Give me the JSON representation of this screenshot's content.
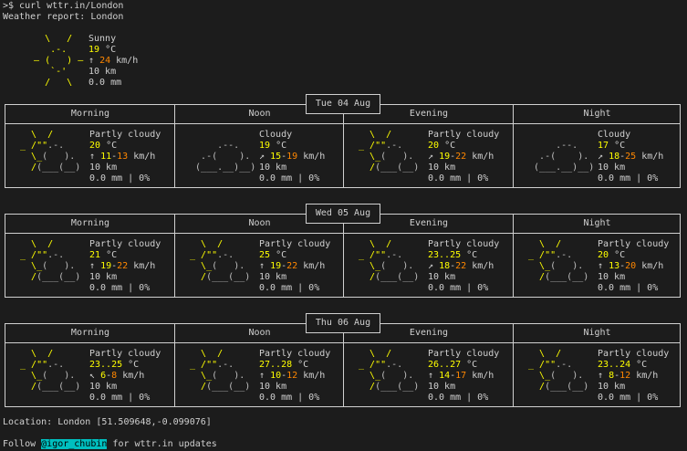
{
  "prompt": ">$ curl wttr.in/London",
  "report_title": "Weather report: London",
  "current": {
    "condition": "Sunny",
    "temp": "19",
    "temp_unit": "°C",
    "wind_arrow": "↑",
    "wind_speed": "24",
    "wind_unit": "km/h",
    "visibility": "10 km",
    "precip": "0.0 mm"
  },
  "columns": [
    "Morning",
    "Noon",
    "Evening",
    "Night"
  ],
  "days": [
    {
      "label": "Tue 04 Aug",
      "cells": [
        {
          "cond": "Partly cloudy",
          "icon": "partly-cloudy",
          "temp": "20",
          "arrow": "↑",
          "wind_lo": "11",
          "wind_hi": "13",
          "vis": "10 km",
          "precip": "0.0 mm | 0%"
        },
        {
          "cond": "Cloudy",
          "icon": "cloudy",
          "temp": "19",
          "arrow": "↗",
          "wind_lo": "15",
          "wind_hi": "19",
          "vis": "10 km",
          "precip": "0.0 mm | 0%"
        },
        {
          "cond": "Partly cloudy",
          "icon": "partly-cloudy",
          "temp": "20",
          "arrow": "↗",
          "wind_lo": "19",
          "wind_hi": "22",
          "vis": "10 km",
          "precip": "0.0 mm | 0%"
        },
        {
          "cond": "Cloudy",
          "icon": "cloudy",
          "temp": "17",
          "arrow": "↗",
          "wind_lo": "18",
          "wind_hi": "25",
          "vis": "10 km",
          "precip": "0.0 mm | 0%"
        }
      ]
    },
    {
      "label": "Wed 05 Aug",
      "cells": [
        {
          "cond": "Partly cloudy",
          "icon": "partly-cloudy",
          "temp": "21",
          "arrow": "↑",
          "wind_lo": "19",
          "wind_hi": "22",
          "vis": "10 km",
          "precip": "0.0 mm | 0%"
        },
        {
          "cond": "Partly cloudy",
          "icon": "partly-cloudy",
          "temp": "25",
          "arrow": "↑",
          "wind_lo": "19",
          "wind_hi": "22",
          "vis": "10 km",
          "precip": "0.0 mm | 0%"
        },
        {
          "cond": "Partly cloudy",
          "icon": "partly-cloudy",
          "temp": "23..25",
          "arrow": "↗",
          "wind_lo": "18",
          "wind_hi": "22",
          "vis": "10 km",
          "precip": "0.0 mm | 0%"
        },
        {
          "cond": "Partly cloudy",
          "icon": "partly-cloudy",
          "temp": "20",
          "arrow": "↑",
          "wind_lo": "13",
          "wind_hi": "20",
          "vis": "10 km",
          "precip": "0.0 mm | 0%"
        }
      ]
    },
    {
      "label": "Thu 06 Aug",
      "cells": [
        {
          "cond": "Partly cloudy",
          "icon": "partly-cloudy",
          "temp": "23..25",
          "arrow": "↖",
          "wind_lo": "6",
          "wind_hi": "8",
          "vis": "10 km",
          "precip": "0.0 mm | 0%"
        },
        {
          "cond": "Partly cloudy",
          "icon": "partly-cloudy",
          "temp": "27..28",
          "arrow": "↑",
          "wind_lo": "10",
          "wind_hi": "12",
          "vis": "10 km",
          "precip": "0.0 mm | 0%"
        },
        {
          "cond": "Partly cloudy",
          "icon": "partly-cloudy",
          "temp": "26..27",
          "arrow": "↑",
          "wind_lo": "14",
          "wind_hi": "17",
          "vis": "10 km",
          "precip": "0.0 mm | 0%"
        },
        {
          "cond": "Partly cloudy",
          "icon": "partly-cloudy",
          "temp": "23..24",
          "arrow": "↑",
          "wind_lo": "8",
          "wind_hi": "12",
          "vis": "10 km",
          "precip": "0.0 mm | 0%"
        }
      ]
    }
  ],
  "location": "Location: London [51.509648,-0.099076]",
  "follow": {
    "prefix": "Follow ",
    "handle": "@igor_chubin",
    "suffix": " for wttr.in updates"
  },
  "colors": {
    "background": "#1c1c1c",
    "text": "#d0d0d0",
    "sun": "#ffff00",
    "warm": "#ff8700",
    "link_bg": "#00bfbf"
  }
}
